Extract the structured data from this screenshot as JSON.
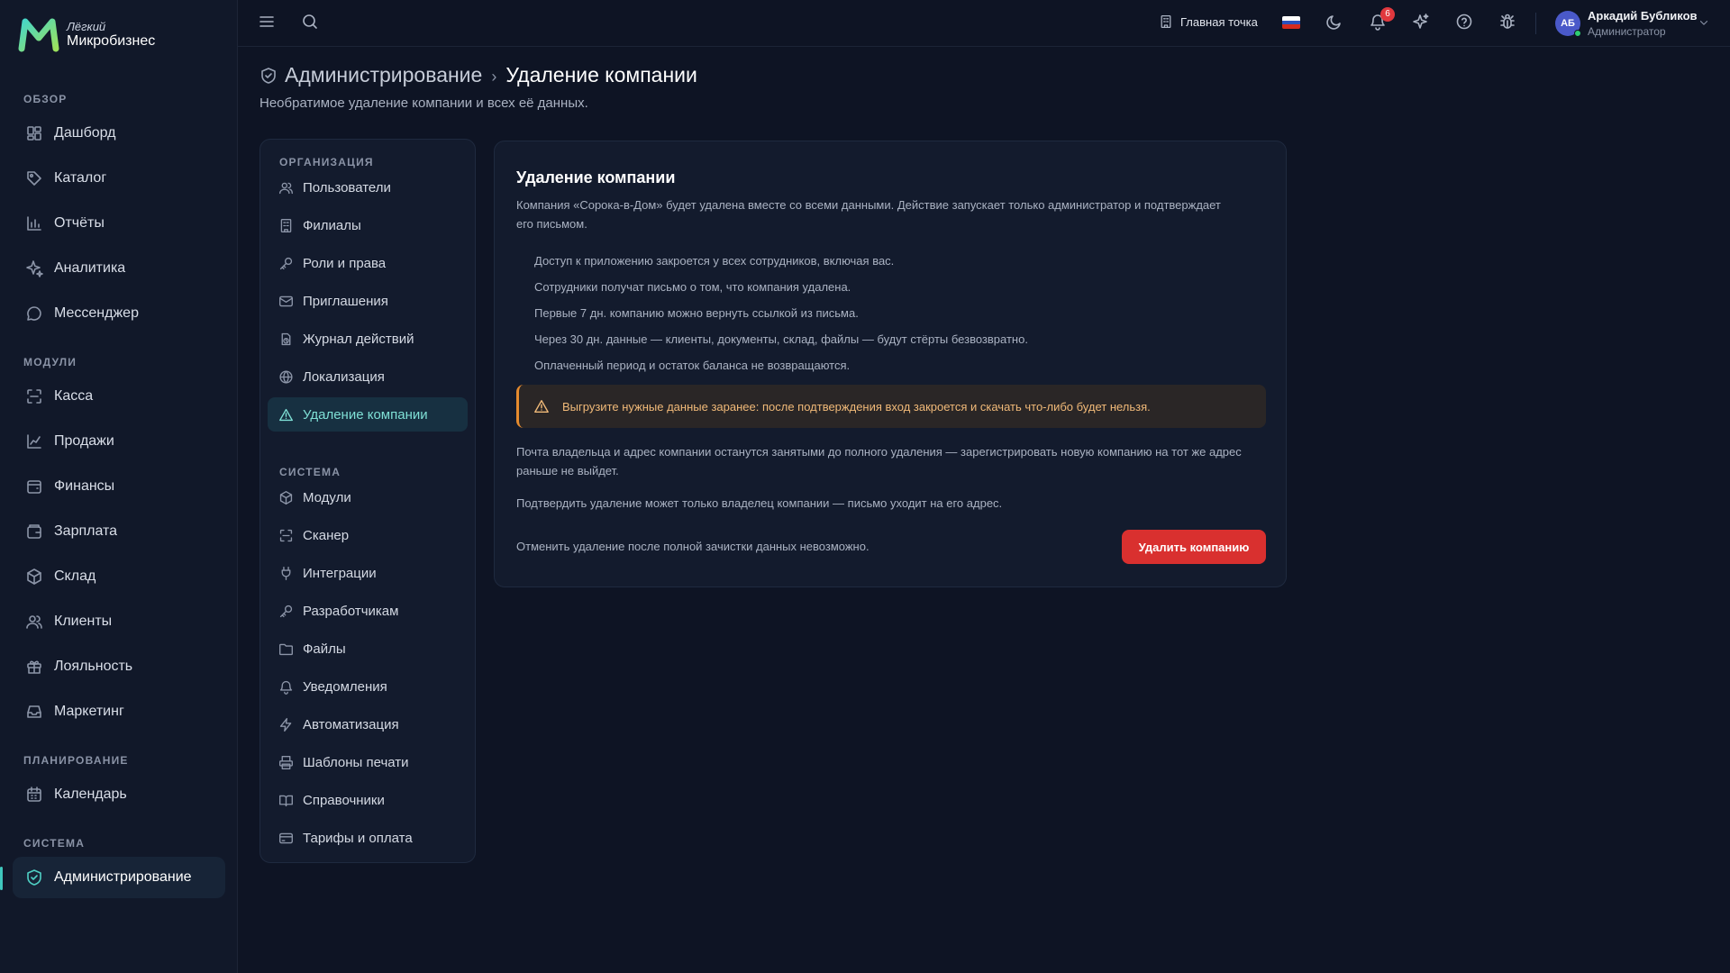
{
  "brand": {
    "line1": "Лёгкий",
    "line2": "Микробизнес"
  },
  "sidebar": {
    "sections": [
      {
        "title": "ОБЗОР",
        "items": [
          {
            "label": "Дашборд",
            "icon": "dashboard-icon"
          },
          {
            "label": "Каталог",
            "icon": "tag-icon"
          },
          {
            "label": "Отчёты",
            "icon": "bar-chart-icon"
          },
          {
            "label": "Аналитика",
            "icon": "sparkles-icon"
          },
          {
            "label": "Мессенджер",
            "icon": "chat-icon"
          }
        ]
      },
      {
        "title": "МОДУЛИ",
        "items": [
          {
            "label": "Касса",
            "icon": "scan-icon"
          },
          {
            "label": "Продажи",
            "icon": "line-chart-icon"
          },
          {
            "label": "Финансы",
            "icon": "wallet-icon"
          },
          {
            "label": "Зарплата",
            "icon": "wallet-icon"
          },
          {
            "label": "Склад",
            "icon": "box-icon"
          },
          {
            "label": "Клиенты",
            "icon": "users-icon"
          },
          {
            "label": "Лояльность",
            "icon": "gift-icon"
          },
          {
            "label": "Маркетинг",
            "icon": "inbox-icon"
          }
        ]
      },
      {
        "title": "ПЛАНИРОВАНИЕ",
        "items": [
          {
            "label": "Календарь",
            "icon": "calendar-icon"
          }
        ]
      },
      {
        "title": "СИСТЕМА",
        "items": [
          {
            "label": "Администрирование",
            "icon": "shield-icon",
            "active": true
          }
        ]
      }
    ]
  },
  "topbar": {
    "location": "Главная точка",
    "notifications_count": "6",
    "user": {
      "initials": "АБ",
      "name": "Аркадий Бубликов",
      "role": "Администратор"
    }
  },
  "header": {
    "parent": "Администрирование",
    "separator": "›",
    "current": "Удаление компании",
    "subtitle": "Необратимое удаление компании и всех её данных."
  },
  "subnav": {
    "sections": [
      {
        "title": "ОРГАНИЗАЦИЯ",
        "items": [
          {
            "label": "Пользователи",
            "icon": "users-icon"
          },
          {
            "label": "Филиалы",
            "icon": "building-icon"
          },
          {
            "label": "Роли и права",
            "icon": "key-icon"
          },
          {
            "label": "Приглашения",
            "icon": "mail-icon"
          },
          {
            "label": "Журнал действий",
            "icon": "history-icon"
          },
          {
            "label": "Локализация",
            "icon": "globe-icon"
          },
          {
            "label": "Удаление компании",
            "icon": "warning-icon",
            "active": true
          }
        ]
      },
      {
        "title": "СИСТЕМА",
        "items": [
          {
            "label": "Модули",
            "icon": "box-icon"
          },
          {
            "label": "Сканер",
            "icon": "scan-icon"
          },
          {
            "label": "Интеграции",
            "icon": "plug-icon"
          },
          {
            "label": "Разработчикам",
            "icon": "key-icon"
          },
          {
            "label": "Файлы",
            "icon": "folder-icon"
          },
          {
            "label": "Уведомления",
            "icon": "bell-icon"
          },
          {
            "label": "Автоматизация",
            "icon": "zap-icon"
          },
          {
            "label": "Шаблоны печати",
            "icon": "printer-icon"
          },
          {
            "label": "Справочники",
            "icon": "book-icon"
          },
          {
            "label": "Тарифы и оплата",
            "icon": "credit-card-icon"
          }
        ]
      }
    ]
  },
  "card": {
    "title": "Удаление компании",
    "description": "Компания «Сорока-в-Дом» будет удалена вместе со всеми данными. Действие запускает только администратор и подтверждает его письмом.",
    "bullets": [
      "Доступ к приложению закроется у всех сотрудников, включая вас.",
      "Сотрудники получат письмо о том, что компания удалена.",
      "Первые 7 дн. компанию можно вернуть ссылкой из письма.",
      "Через 30 дн. данные — клиенты, документы, склад, файлы — будут стёрты безвозвратно.",
      "Оплаченный период и остаток баланса не возвращаются."
    ],
    "warning": "Выгрузите нужные данные заранее: после подтверждения вход закроется и скачать что-либо будет нельзя.",
    "note_email": "Почта владельца и адрес компании останутся занятыми до полного удаления — зарегистрировать новую компанию на тот же адрес раньше не выйдет.",
    "note_owner": "Подтвердить удаление может только владелец компании — письмо уходит на его адрес.",
    "note_irreversible": "Отменить удаление после полной зачистки данных невозможно.",
    "delete_button": "Удалить компанию"
  },
  "colors": {
    "accent": "#3fc7bd",
    "danger": "#d9302f",
    "warning": "#e58b2e",
    "background": "#0e1424"
  }
}
